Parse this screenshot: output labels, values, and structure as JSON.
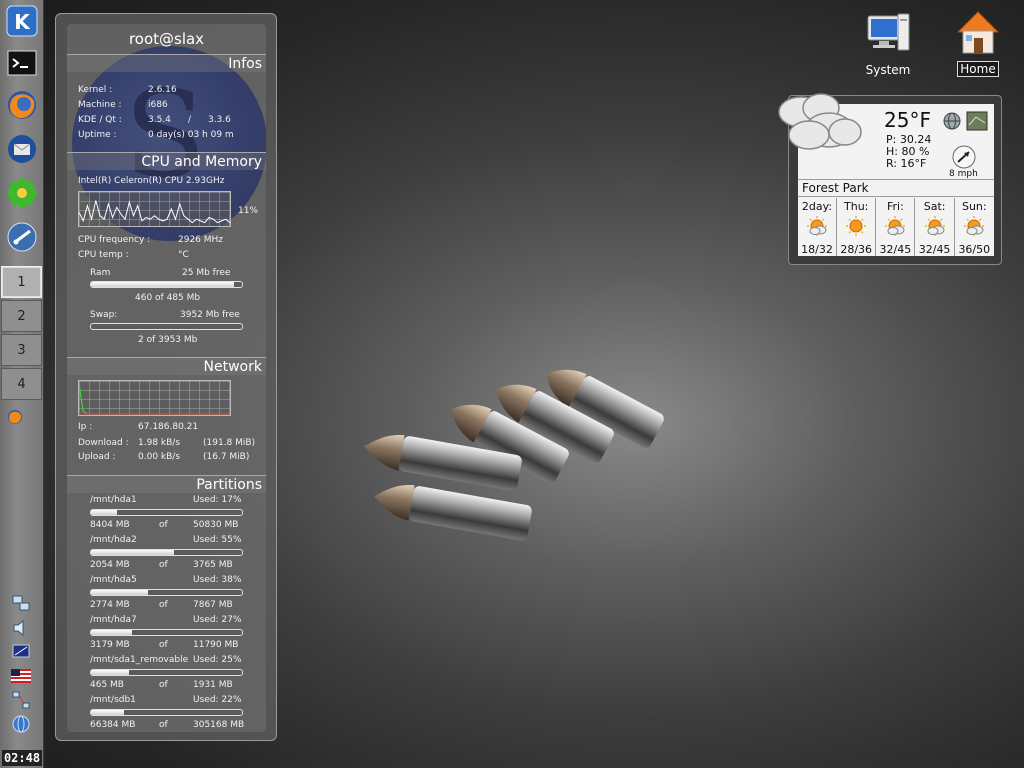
{
  "desktop": {
    "icons": [
      {
        "label": "System"
      },
      {
        "label": "Home"
      }
    ]
  },
  "kicker": {
    "launchers": [
      "kde-menu-icon",
      "konsole-icon",
      "firefox-icon",
      "thunderbird-icon",
      "icq-icon",
      "ktorrent-icon"
    ],
    "desktops": [
      "1",
      "2",
      "3",
      "4"
    ],
    "active_desktop": "1",
    "tray": [
      "network-icon",
      "volume-icon",
      "display-icon",
      "us-flag-icon",
      "network-share-icon",
      "globe-icon"
    ],
    "clock": "02:48"
  },
  "monitor": {
    "host": "root@slax",
    "infos": {
      "title": "Infos",
      "rows": [
        {
          "label": "Kernel :",
          "value": "2.6.16"
        },
        {
          "label": "Machine :",
          "value": "i686"
        },
        {
          "label": "KDE / Qt :",
          "value": "3.5.4",
          "sep": "/",
          "value2": "3.3.6"
        },
        {
          "label": "Uptime :",
          "value": "0 day(s)  03 h 09 m"
        }
      ]
    },
    "cpu": {
      "title": "CPU and Memory",
      "model": "Intel(R) Celeron(R) CPU 2.93GHz",
      "load": "11%",
      "load_history": [
        0.4,
        0.15,
        0.6,
        0.2,
        0.75,
        0.3,
        0.2,
        0.65,
        0.25,
        0.55,
        0.35,
        0.2,
        0.7,
        0.3,
        0.6,
        0.15,
        0.25,
        0.2,
        0.3,
        0.2,
        0.15,
        0.2,
        0.5,
        0.2,
        0.65,
        0.3,
        0.2,
        0.1,
        0.2,
        0.15,
        0.1,
        0.25,
        0.2,
        0.1,
        0.15,
        0.2,
        0.1
      ],
      "freq_label": "CPU frequency :",
      "freq_value": "2926 MHz",
      "temp_label": "CPU temp :",
      "temp_value": "°C",
      "ram_label": "Ram",
      "ram_free": "25 Mb free",
      "ram_used": "460 of 485 Mb",
      "ram_fraction": 0.95,
      "swap_label": "Swap:",
      "swap_free": "3952 Mb free",
      "swap_used": "2 of 3953 Mb",
      "swap_fraction": 0.0
    },
    "network": {
      "title": "Network",
      "ip_label": "Ip :",
      "ip": "67.186.80.21",
      "download_label": "Download :",
      "download": "1.98 kB/s",
      "download_total": "(191.8 MiB)",
      "upload_label": "Upload :",
      "upload": "0.00 kB/s",
      "upload_total": "(16.7 MiB)"
    },
    "partitions": {
      "title": "Partitions",
      "of_word": "of",
      "items": [
        {
          "name": "/mnt/hda1",
          "used": "Used: 17%",
          "fraction": 0.17,
          "size": "8404 MB",
          "total": "50830 MB"
        },
        {
          "name": "/mnt/hda2",
          "used": "Used: 55%",
          "fraction": 0.55,
          "size": "2054 MB",
          "total": "3765 MB"
        },
        {
          "name": "/mnt/hda5",
          "used": "Used: 38%",
          "fraction": 0.38,
          "size": "2774 MB",
          "total": "7867 MB"
        },
        {
          "name": "/mnt/hda7",
          "used": "Used: 27%",
          "fraction": 0.27,
          "size": "3179 MB",
          "total": "11790 MB"
        },
        {
          "name": "/mnt/sda1_removable",
          "used": "Used: 25%",
          "fraction": 0.25,
          "size": "465 MB",
          "total": "1931 MB"
        },
        {
          "name": "/mnt/sdb1",
          "used": "Used: 22%",
          "fraction": 0.22,
          "size": "66384 MB",
          "total": "305168 MB"
        }
      ]
    }
  },
  "weather": {
    "temp": "25°F",
    "pressure": "P:  30.24",
    "humidity": "H:  80 %",
    "real": "R:  16°F",
    "wind": "8 mph",
    "location": "Forest Park",
    "forecast": [
      {
        "day": "2day:",
        "temps": "18/32",
        "icon": "partly-cloudy-icon"
      },
      {
        "day": "Thu:",
        "temps": "28/36",
        "icon": "sunny-icon"
      },
      {
        "day": "Fri:",
        "temps": "32/45",
        "icon": "partly-cloudy-icon"
      },
      {
        "day": "Sat:",
        "temps": "32/45",
        "icon": "partly-cloudy-icon"
      },
      {
        "day": "Sun:",
        "temps": "36/50",
        "icon": "partly-cloudy-icon"
      }
    ]
  }
}
